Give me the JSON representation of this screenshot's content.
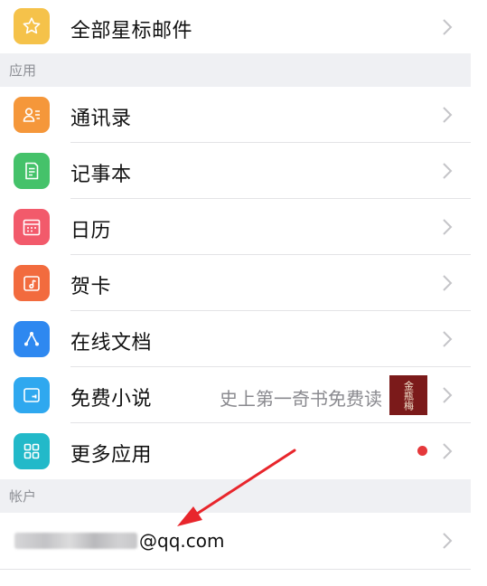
{
  "top_item": {
    "label": "全部星标邮件",
    "icon": "star-icon",
    "color": "#f5c24a"
  },
  "sections": {
    "apps_header": "应用",
    "account_header": "帐户"
  },
  "apps": [
    {
      "label": "通讯录",
      "icon": "contacts-icon",
      "color": "#f5973a"
    },
    {
      "label": "记事本",
      "icon": "notepad-icon",
      "color": "#45c26a"
    },
    {
      "label": "日历",
      "icon": "calendar-icon",
      "color": "#f25a6b"
    },
    {
      "label": "贺卡",
      "icon": "greeting-card-icon",
      "color": "#f26b3e"
    },
    {
      "label": "在线文档",
      "icon": "document-icon",
      "color": "#2e88f0"
    },
    {
      "label": "免费小说",
      "icon": "novel-icon",
      "color": "#2fa8ef",
      "subtitle": "史上第一奇书免费读",
      "book_text": "金瓶梅"
    },
    {
      "label": "更多应用",
      "icon": "grid-icon",
      "color": "#22b9c9",
      "badge_color": "#e5383b"
    }
  ],
  "account": {
    "email_suffix": "@qq.com"
  },
  "annotation": {
    "arrow_color": "#e8262c"
  }
}
